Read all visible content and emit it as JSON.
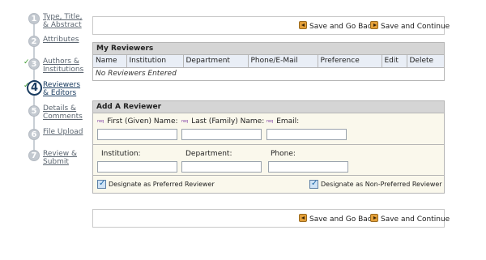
{
  "steps": [
    {
      "number": "1",
      "label": "Type, Title, & Abstract",
      "completed": false,
      "active": false
    },
    {
      "number": "2",
      "label": "Attributes",
      "completed": false,
      "active": false
    },
    {
      "number": "3",
      "label": "Authors & Institutions",
      "completed": true,
      "active": false
    },
    {
      "number": "4",
      "label": "Reviewers & Editors",
      "completed": true,
      "active": true
    },
    {
      "number": "5",
      "label": "Details & Comments",
      "completed": false,
      "active": false
    },
    {
      "number": "6",
      "label": "File Upload",
      "completed": false,
      "active": false
    },
    {
      "number": "7",
      "label": "Review & Submit",
      "completed": false,
      "active": false
    }
  ],
  "nav_top": {
    "back_label": "Save and Go Back",
    "continue_label": "Save and Continue"
  },
  "nav_bottom": {
    "back_label": "Save and Go Back",
    "continue_label": "Save and Continue"
  },
  "my_reviewers": {
    "title": "My Reviewers",
    "columns": [
      "Name",
      "Institution",
      "Department",
      "Phone/E-Mail",
      "Preference",
      "Edit",
      "Delete"
    ],
    "empty_message": "No Reviewers Entered"
  },
  "add_reviewer": {
    "title": "Add A Reviewer",
    "required_marker": "req",
    "first_name_label": "First (Given) Name:",
    "last_name_label": "Last (Family) Name:",
    "email_label": "Email:",
    "institution_label": "Institution:",
    "department_label": "Department:",
    "phone_label": "Phone:",
    "first_name_value": "",
    "last_name_value": "",
    "email_value": "",
    "institution_value": "",
    "department_value": "",
    "phone_value": "",
    "preferred_label": "Designate as Preferred Reviewer",
    "non_preferred_label": "Designate as Non-Preferred Reviewer"
  },
  "colors": {
    "panel_header": "#d5d5d5",
    "table_header": "#e9eef6",
    "form_background": "#faf8ec",
    "active_step": "#1a3c60",
    "check_green": "#3a9a2a",
    "button_icon": "#e3a03a"
  },
  "icons": {
    "back": "arrow-left-icon",
    "continue": "arrow-right-icon",
    "completed": "checkmark-icon",
    "checkbox": "checkbox-checked-icon"
  }
}
